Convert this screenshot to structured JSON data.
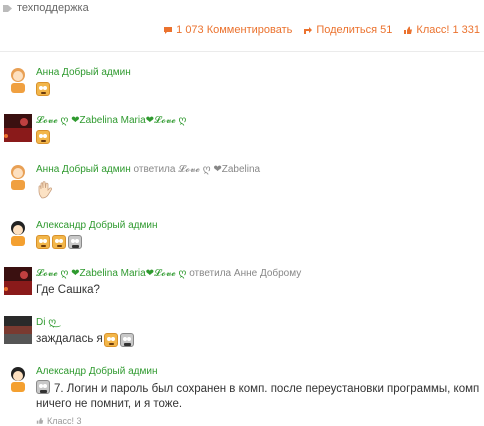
{
  "header": {
    "tag": "техподдержка",
    "comments": "1 073 Комментировать",
    "share": "Поделиться 51",
    "like": "Класс! 1 331"
  },
  "comments": [
    {
      "author": "Анна Добрый админ",
      "reply": "",
      "text": ""
    },
    {
      "author": "𝓛𝓸𝓿𝓮 ღ ❤Zabelina Maria❤𝓛𝓸𝓿𝓮 ღ",
      "reply": "",
      "text": ""
    },
    {
      "author": "Анна Добрый админ",
      "reply": "ответила 𝓛𝓸𝓿𝓮 ღ ❤Zabelina",
      "text": ""
    },
    {
      "author": "Александр Добрый админ",
      "reply": "",
      "text": ""
    },
    {
      "author": "𝓛𝓸𝓿𝓮 ღ ❤Zabelina Maria❤𝓛𝓸𝓿𝓮 ღ",
      "reply": "ответила Анне Доброму",
      "text": "Где Сашка?"
    },
    {
      "author": "Di ღ͜",
      "reply": "",
      "text": "заждалась я"
    },
    {
      "author": "Александр Добрый админ",
      "reply": "",
      "text": "7. Логин и пароль был сохранен в комп. после переустановки программы, комп ничего не помнит, и я тоже.",
      "likes": "Класс! 3"
    }
  ],
  "colors": {
    "accent": "#eb722e",
    "author": "#2f9a2f",
    "meta": "#888888"
  }
}
